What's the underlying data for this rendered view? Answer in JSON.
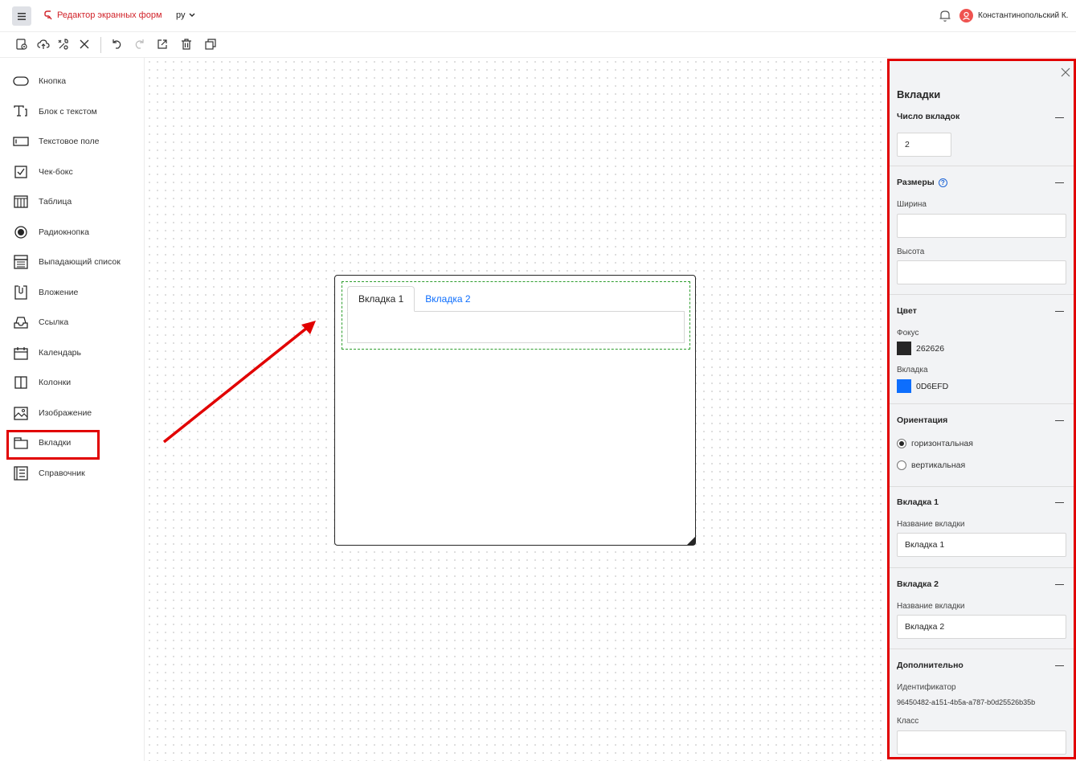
{
  "header": {
    "app_title": "Редактор экранных форм",
    "language": "ру",
    "user_name": "Константинопольский К."
  },
  "palette": {
    "items": [
      {
        "label": "Кнопка",
        "icon": "button-icon"
      },
      {
        "label": "Блок с текстом",
        "icon": "text-block-icon"
      },
      {
        "label": "Текстовое поле",
        "icon": "text-field-icon"
      },
      {
        "label": "Чек-бокс",
        "icon": "checkbox-icon"
      },
      {
        "label": "Таблица",
        "icon": "table-icon"
      },
      {
        "label": "Радиокнопка",
        "icon": "radio-icon"
      },
      {
        "label": "Выпадающий список",
        "icon": "dropdown-icon"
      },
      {
        "label": "Вложение",
        "icon": "attachment-icon"
      },
      {
        "label": "Ссылка",
        "icon": "link-icon"
      },
      {
        "label": "Календарь",
        "icon": "calendar-icon"
      },
      {
        "label": "Колонки",
        "icon": "columns-icon"
      },
      {
        "label": "Изображение",
        "icon": "image-icon"
      },
      {
        "label": "Вкладки",
        "icon": "tabs-icon"
      },
      {
        "label": "Справочник",
        "icon": "reference-icon"
      }
    ]
  },
  "canvas": {
    "tabs": [
      "Вкладка 1",
      "Вкладка 2"
    ]
  },
  "panel": {
    "title": "Вкладки",
    "tab_count": {
      "title": "Число вкладок",
      "value": "2"
    },
    "sizes": {
      "title": "Размеры",
      "help": "?",
      "width_label": "Ширина",
      "width_value": "",
      "height_label": "Высота",
      "height_value": ""
    },
    "color": {
      "title": "Цвет",
      "focus_label": "Фокус",
      "focus_value": "262626",
      "focus_color": "#262626",
      "tab_label": "Вкладка",
      "tab_value": "0D6EFD",
      "tab_color": "#0D6EFD"
    },
    "orientation": {
      "title": "Ориентация",
      "options": [
        "горизонтальная",
        "вертикальная"
      ],
      "selected": "горизонтальная"
    },
    "tab1": {
      "title": "Вкладка 1",
      "name_label": "Название вкладки",
      "name_value": "Вкладка 1"
    },
    "tab2": {
      "title": "Вкладка 2",
      "name_label": "Название вкладки",
      "name_value": "Вкладка 2"
    },
    "extra": {
      "title": "Дополнительно",
      "id_label": "Идентификатор",
      "id_value": "96450482-a151-4b5a-a787-b0d25526b35b",
      "class_label": "Класс",
      "class_value": ""
    }
  },
  "colors": {
    "brand": "#d1232a",
    "highlight": "#e10000",
    "accent": "#0d6efd"
  }
}
